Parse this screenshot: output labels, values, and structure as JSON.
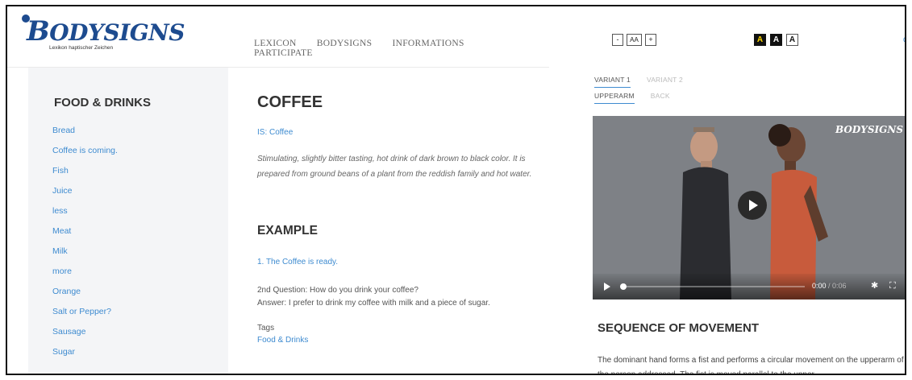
{
  "logo": {
    "title_first": "B",
    "title_rest": "ODYSIGNS",
    "subtitle": "Lexikon haptischer Zeichen"
  },
  "nav": {
    "items": [
      "LEXICON",
      "BODYSIGNS",
      "INFORMATIONS",
      "PARTICIPATE"
    ]
  },
  "sidebar": {
    "title": "FOOD & DRINKS",
    "items": [
      "Bread",
      "Coffee is coming.",
      "Fish",
      "Juice",
      "less",
      "Meat",
      "Milk",
      "more",
      "Orange",
      "Salt or Pepper?",
      "Sausage",
      "Sugar"
    ]
  },
  "main": {
    "title": "COFFEE",
    "is_link": "IS: Coffee",
    "description": "Stimulating, slightly bitter tasting, hot drink of dark brown to black color. It is prepared from ground beans of a plant from the reddish family and hot water.",
    "example_title": "EXAMPLE",
    "example_link": "1. The Coffee is ready.",
    "question": "2nd Question: How do you drink your coffee?",
    "answer": "Answer: I prefer to drink my coffee with milk and a piece of sugar.",
    "tags_label": "Tags",
    "tags_value": "Food & Drinks"
  },
  "right": {
    "font_controls": [
      "-",
      "AA",
      "+"
    ],
    "contrast_controls": [
      "A",
      "A",
      "A"
    ],
    "language": "de",
    "variant_tabs": [
      "VARIANT 1",
      "VARIANT 2"
    ],
    "location_tabs": [
      "UPPERARM",
      "BACK"
    ],
    "video": {
      "watermark": "BODYSIGNS",
      "time_current": "0:00",
      "time_separator": " / ",
      "time_duration": "0:06"
    },
    "sequence_title": "SEQUENCE OF MOVEMENT",
    "sequence_text": "The dominant hand forms a fist and performs a circular movement on the upperarm of the person addressed. The fist is moved parallel to the upper"
  },
  "colors": {
    "link": "#3e8bd0",
    "brand": "#1d4b8f",
    "sidebar_bg": "#f4f5f7",
    "contrast_yellow": "#ffd800"
  }
}
